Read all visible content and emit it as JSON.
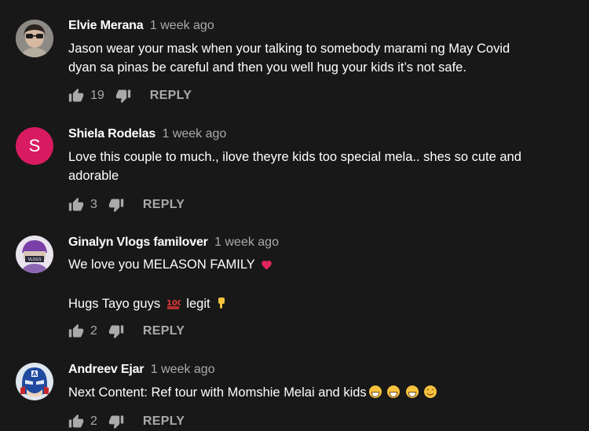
{
  "comments": [
    {
      "author": "Elvie Merana",
      "time": "1 week ago",
      "avatar": "photo-avatar-sunglasses",
      "lines": [
        "Jason wear your mask when your talking to somebody marami ng May Covid",
        "dyan sa pinas be careful and then you well  hug your kids it’s not safe."
      ],
      "likes": "19",
      "reply_label": "REPLY"
    },
    {
      "author": "Shiela Rodelas",
      "time": "1 week ago",
      "avatar_letter": "S",
      "avatar_color": "#d81b60",
      "lines": [
        "Love this couple to much., ilove theyre kids too special mela.. shes so cute and",
        "adorable"
      ],
      "likes": "3",
      "reply_label": "REPLY"
    },
    {
      "author": "Ginalyn Vlogs familover",
      "time": "1 week ago",
      "avatar": "photo-avatar-purple",
      "line1": "We love you MELASON FAMILY",
      "line1_emoji": "❤️",
      "line2_a": "Hugs Tayo guys",
      "line2_emoji1": "💯",
      "line2_b": "legit",
      "line2_emoji2": "👇",
      "likes": "2",
      "reply_label": "REPLY"
    },
    {
      "author": "Andreev Ejar",
      "time": "1 week ago",
      "avatar": "captain-america-mask-avatar",
      "line1": "Next Content: Ref tour with Momshie Melai and kids",
      "line1_emojis": "😁 😁 😁 😊",
      "likes": "2",
      "reply_label": "REPLY"
    }
  ],
  "colors": {
    "background": "#181818",
    "author": "#ffffff",
    "secondary": "#aaaaaa",
    "avatar_s": "#d81b60"
  }
}
